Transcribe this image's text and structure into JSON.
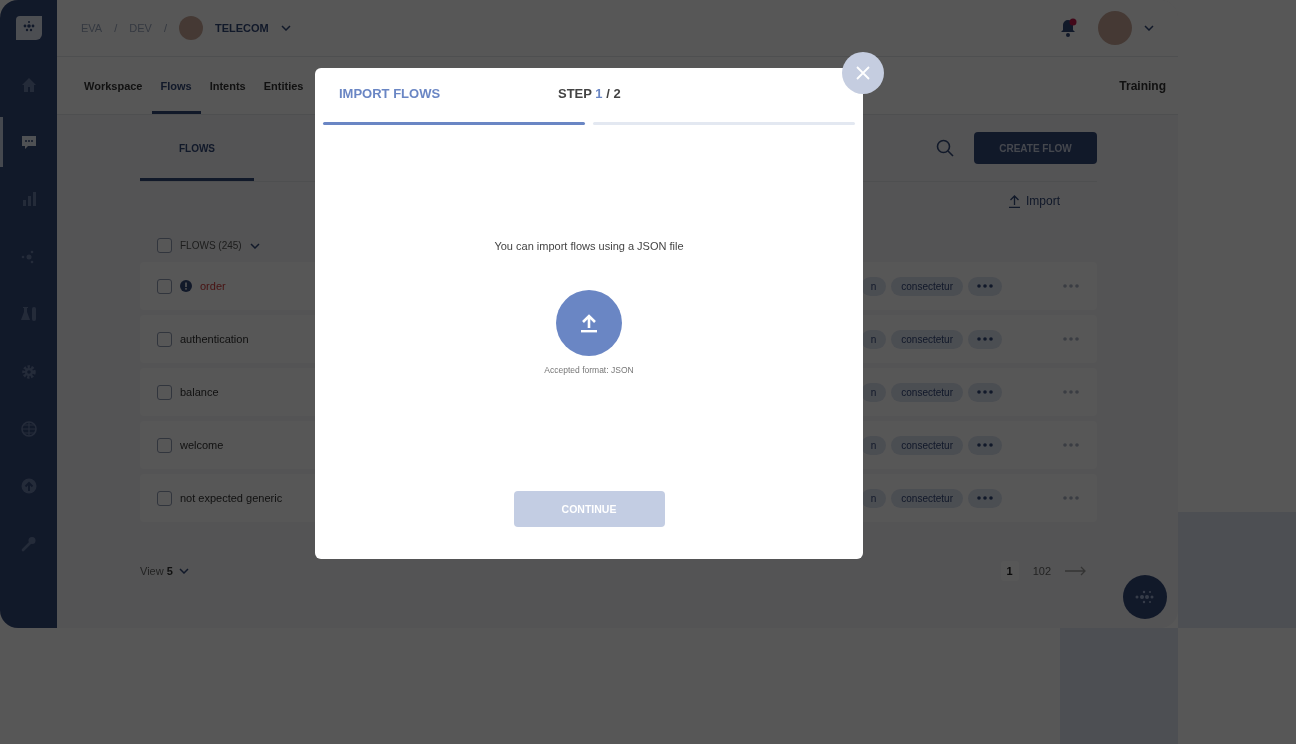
{
  "sidebar": {
    "items": [
      {
        "selected": false
      },
      {
        "selected": true
      },
      {
        "selected": false
      },
      {
        "selected": false
      },
      {
        "selected": false
      },
      {
        "selected": false
      },
      {
        "selected": false
      },
      {
        "selected": false
      },
      {
        "selected": false
      }
    ]
  },
  "breadcrumb": [
    "EVA",
    "/",
    "DEV",
    "/"
  ],
  "project": "TELECOM",
  "notifications": {
    "unread": true
  },
  "nav_tabs": [
    {
      "label": "Workspace",
      "selected": false
    },
    {
      "label": "Flows",
      "selected": true
    },
    {
      "label": "Intents",
      "selected": false
    },
    {
      "label": "Entities",
      "selected": false
    }
  ],
  "nav_right": "Training",
  "subtabs": [
    {
      "label": "FLOWS",
      "selected": true
    }
  ],
  "create_button": "CREATE FLOW",
  "import_link": "Import",
  "list": {
    "header": "FLOWS (245)",
    "checked": false,
    "rows": [
      {
        "name": "order",
        "checked": false,
        "warning": true,
        "tags": [
          "n",
          "consectetur"
        ]
      },
      {
        "name": "authentication",
        "checked": false,
        "warning": false,
        "tags": [
          "n",
          "consectetur"
        ]
      },
      {
        "name": "balance",
        "checked": false,
        "warning": false,
        "tags": [
          "n",
          "consectetur"
        ]
      },
      {
        "name": "welcome",
        "checked": false,
        "warning": false,
        "tags": [
          "n",
          "consectetur"
        ]
      },
      {
        "name": "not expected generic",
        "checked": false,
        "warning": false,
        "tags": [
          "n",
          "consectetur"
        ]
      }
    ]
  },
  "footer": {
    "view_label": "View",
    "view_value": "5",
    "pages": [
      {
        "label": "1",
        "selected": true
      },
      {
        "label": "102",
        "selected": false
      }
    ]
  },
  "modal": {
    "title": "IMPORT FLOWS",
    "step_label": "STEP",
    "step_current": "1",
    "step_total": "/ 2",
    "progress": [
      {
        "filled": true
      },
      {
        "filled": false
      }
    ],
    "message": "You can import flows using a JSON file",
    "caption": "Accepted format: JSON",
    "continue_button": {
      "label": "CONTINUE",
      "disabled": true
    }
  }
}
